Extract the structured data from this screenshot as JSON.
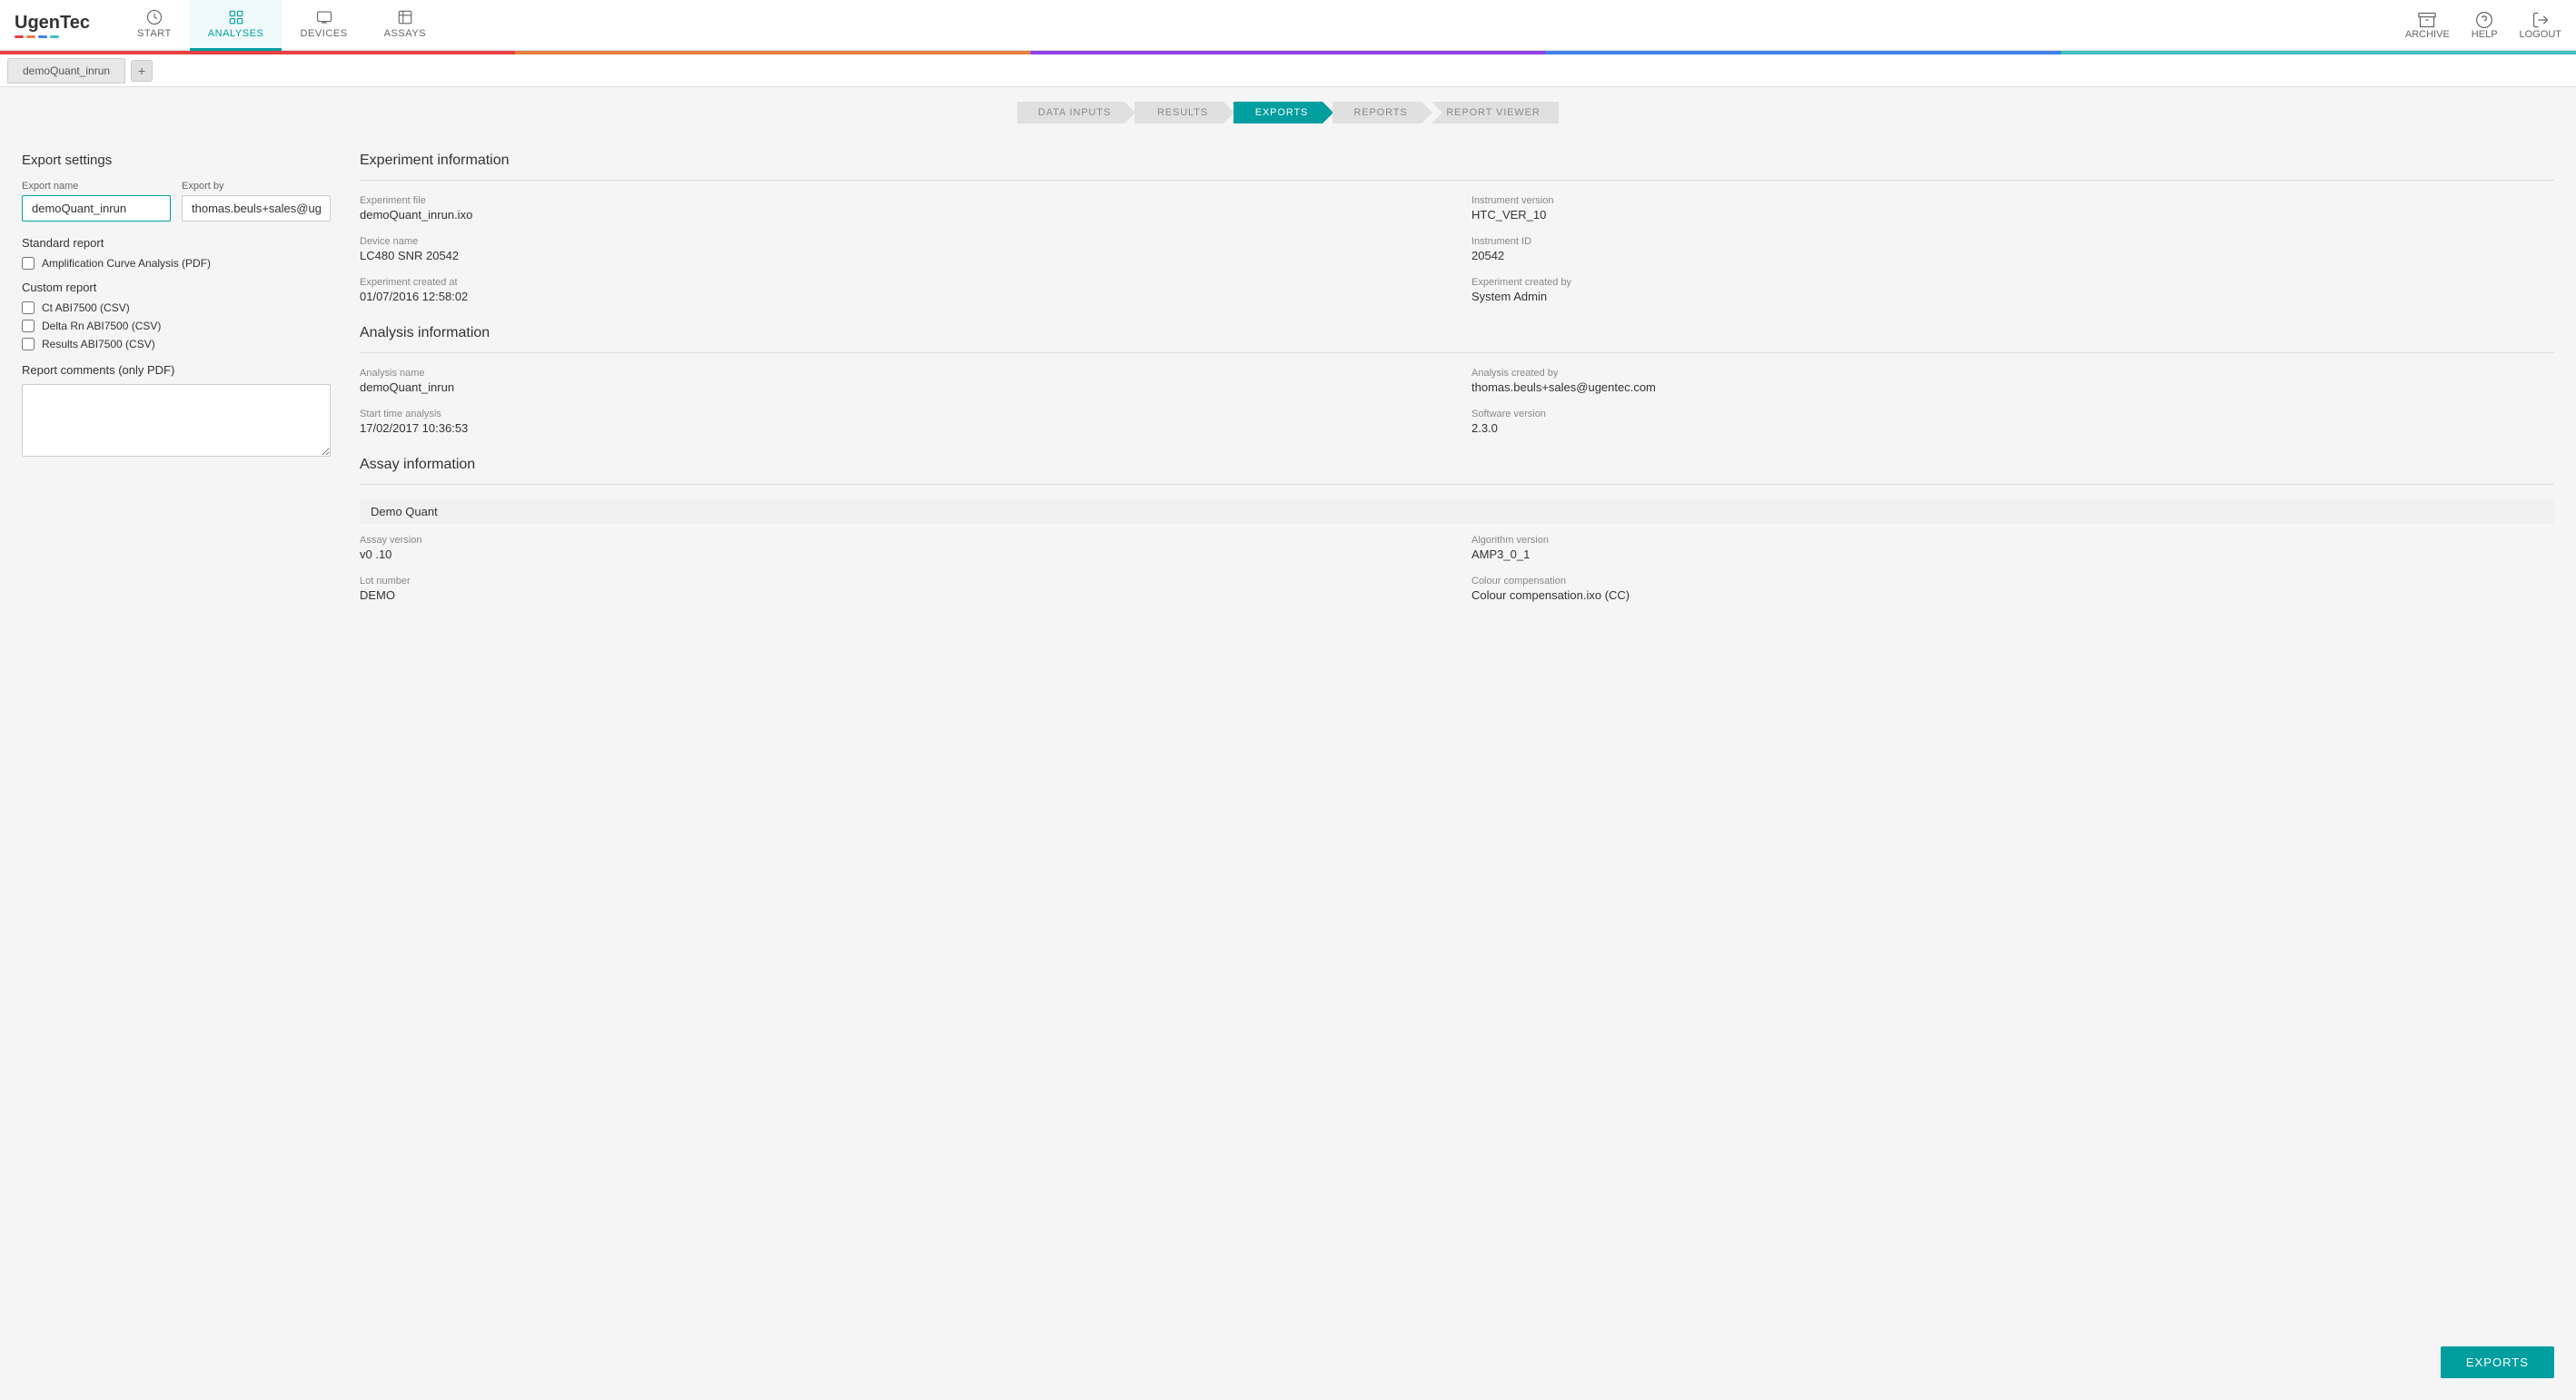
{
  "brand": {
    "name": "UgenTec",
    "dots": [
      "#e84040",
      "#e88040",
      "#4080e8",
      "#40c0c0"
    ]
  },
  "nav": {
    "items": [
      {
        "id": "start",
        "label": "START",
        "active": false
      },
      {
        "id": "analyses",
        "label": "ANALYSES",
        "active": true
      },
      {
        "id": "devices",
        "label": "DEVICES",
        "active": false
      },
      {
        "id": "assays",
        "label": "ASSAYS",
        "active": false
      }
    ],
    "right": [
      {
        "id": "archive",
        "label": "ARCHIVE"
      },
      {
        "id": "help",
        "label": "HELP"
      },
      {
        "id": "logout",
        "label": "LOGOUT"
      }
    ]
  },
  "tab": {
    "name": "demoQuant_inrun",
    "add_label": "+"
  },
  "workflow": {
    "steps": [
      {
        "id": "data-inputs",
        "label": "DATA INPUTS",
        "active": false
      },
      {
        "id": "results",
        "label": "RESULTS",
        "active": false
      },
      {
        "id": "exports",
        "label": "EXPORTS",
        "active": true
      },
      {
        "id": "reports",
        "label": "REPORTS",
        "active": false
      },
      {
        "id": "report-viewer",
        "label": "REPORT VIEWER",
        "active": false
      }
    ]
  },
  "export_settings": {
    "title": "Export settings",
    "export_name_label": "Export name",
    "export_name_value": "demoQuant_inrun",
    "export_by_label": "Export by",
    "export_by_value": "thomas.beuls+sales@ugentec.com",
    "standard_report_title": "Standard report",
    "standard_report_items": [
      {
        "id": "amplification-curve",
        "label": "Amplification Curve Analysis (PDF)",
        "checked": false
      }
    ],
    "custom_report_title": "Custom report",
    "custom_report_items": [
      {
        "id": "ct-abi7500",
        "label": "Ct ABI7500 (CSV)",
        "checked": false
      },
      {
        "id": "delta-rn-abi7500",
        "label": "Delta Rn ABI7500 (CSV)",
        "checked": false
      },
      {
        "id": "results-abi7500",
        "label": "Results ABI7500 (CSV)",
        "checked": false
      }
    ],
    "comments_label": "Report comments (only PDF)",
    "comments_value": "",
    "comments_placeholder": ""
  },
  "experiment_info": {
    "title": "Experiment information",
    "fields": [
      {
        "label": "Experiment file",
        "value": "demoQuant_inrun.ixo",
        "col": "left"
      },
      {
        "label": "Instrument version",
        "value": "HTC_VER_10",
        "col": "right"
      },
      {
        "label": "Device name",
        "value": "LC480 SNR 20542",
        "col": "left"
      },
      {
        "label": "Instrument ID",
        "value": "20542",
        "col": "right"
      },
      {
        "label": "Experiment created at",
        "value": "01/07/2016 12:58:02",
        "col": "left"
      },
      {
        "label": "Experiment created by",
        "value": "System Admin",
        "col": "right"
      }
    ]
  },
  "analysis_info": {
    "title": "Analysis information",
    "fields": [
      {
        "label": "Analysis name",
        "value": "demoQuant_inrun",
        "col": "left"
      },
      {
        "label": "Analysis created by",
        "value": "thomas.beuls+sales@ugentec.com",
        "col": "right"
      },
      {
        "label": "Start time analysis",
        "value": "17/02/2017 10:36:53",
        "col": "left"
      },
      {
        "label": "Software version",
        "value": "2.3.0",
        "col": "right"
      }
    ]
  },
  "assay_info": {
    "title": "Assay information",
    "assay_name": "Demo Quant",
    "fields": [
      {
        "label": "Assay version",
        "value": "v0 .10",
        "col": "left"
      },
      {
        "label": "Algorithm version",
        "value": "AMP3_0_1",
        "col": "right"
      },
      {
        "label": "Lot number",
        "value": "DEMO",
        "col": "left"
      },
      {
        "label": "Colour compensation",
        "value": "Colour compensation.ixo (CC)",
        "col": "right"
      }
    ]
  },
  "exports_button": {
    "label": "EXPORTS"
  }
}
